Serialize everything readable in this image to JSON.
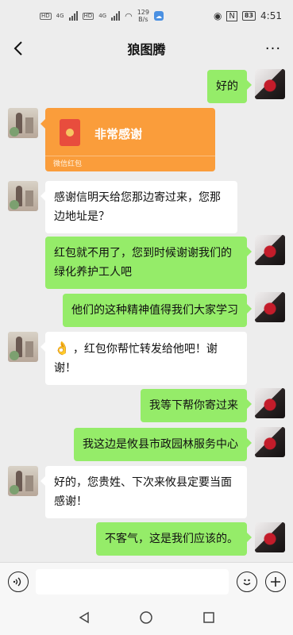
{
  "status_bar": {
    "network_left": "4G",
    "network_right": "4G",
    "speed_value": "129",
    "speed_unit": "B/s",
    "battery": "83",
    "time": "4:51"
  },
  "header": {
    "title": "狼图腾",
    "more_label": "···"
  },
  "messages": [
    {
      "side": "self",
      "type": "text",
      "text": "好的"
    },
    {
      "side": "other",
      "type": "red_packet",
      "title": "非常感谢",
      "footer": "微信红包"
    },
    {
      "side": "other",
      "type": "text",
      "text": "感谢信明天给您那边寄过来，您那边地址是？"
    },
    {
      "side": "self",
      "type": "text",
      "text": "红包就不用了，您到时候谢谢我们的绿化养护工人吧"
    },
    {
      "side": "self",
      "type": "text",
      "text": "他们的这种精神值得我们大家学习"
    },
    {
      "side": "other",
      "type": "text",
      "emoji": "👌",
      "text": "，红包你帮忙转发给他吧！谢谢！"
    },
    {
      "side": "self",
      "type": "text",
      "text": "我等下帮你寄过来"
    },
    {
      "side": "self",
      "type": "text",
      "text": "我这边是攸县市政园林服务中心"
    },
    {
      "side": "other",
      "type": "text",
      "text": "好的，您贵姓、下次来攸县定要当面感谢！"
    },
    {
      "side": "self",
      "type": "text",
      "text": "不客气，这是我们应该的。"
    }
  ],
  "input_bar": {
    "placeholder": "",
    "voice_icon": "voice-icon",
    "emoji_icon": "emoji-icon",
    "plus_icon": "plus-icon"
  },
  "colors": {
    "chat_background": "#ededed",
    "self_bubble": "#95ec69",
    "other_bubble": "#ffffff",
    "red_packet": "#fa9d3b"
  }
}
